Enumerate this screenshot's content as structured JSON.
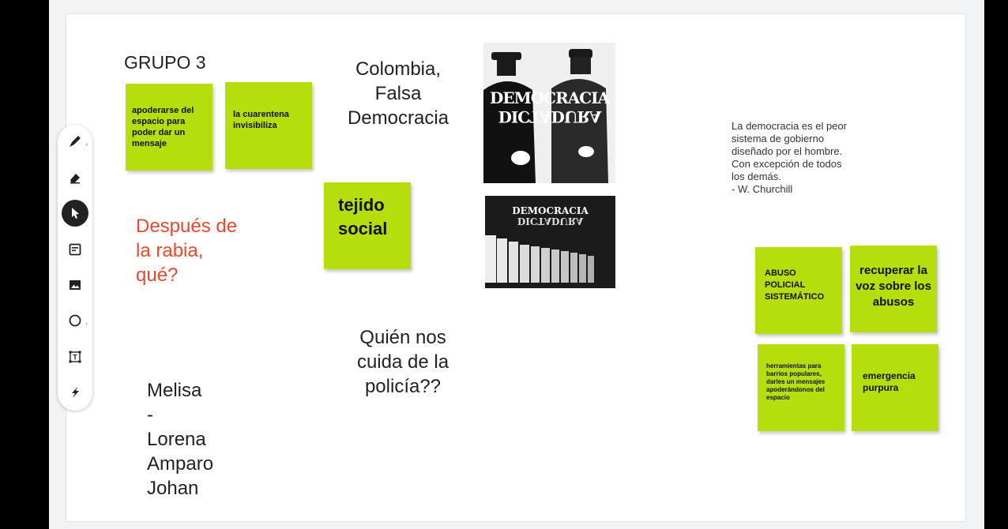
{
  "board": {
    "title": "GRUPO 3",
    "center_title": [
      "Colombia,",
      "Falsa",
      "Democracia"
    ],
    "question_red": [
      "Después de",
      "la rabia,",
      "qué?"
    ],
    "question_police": [
      "Quién nos",
      "cuida de la",
      "policía??"
    ],
    "names": [
      "Melisa",
      "-",
      "Lorena",
      "Amparo",
      "Johan"
    ],
    "quote": [
      "La democracia es el peor",
      "sistema de gobierno",
      "diseñado por el hombre.",
      "Con excepción de todos",
      "los demás.",
      "- W. Churchill"
    ],
    "image1_text": [
      "DEMOCRACIA",
      "DICTADURA"
    ],
    "image2_text": [
      "DEMOCRACIA",
      "DICTADURA"
    ]
  },
  "stickies": {
    "s1": "apoderarse del espacio para poder dar un mensaje",
    "s2": "la cuarentena invisibiliza",
    "s3": "tejido social",
    "s4": "ABUSO POLICIAL SISTEMÁTICO",
    "s5": "recuperar la voz sobre los abusos",
    "s6": "herramientas para barrios populares, darles un mensajes apoderándonos del espacio",
    "s7": "emergencia purpura"
  },
  "colors": {
    "sticky": "#b5de0c",
    "red_text": "#e8492e",
    "toolbar_active": "#222222"
  },
  "toolbar": {
    "tools": [
      "pen-icon",
      "eraser-icon",
      "cursor-icon",
      "sticky-note-icon",
      "image-icon",
      "shape-icon",
      "text-box-icon",
      "laser-icon"
    ],
    "active": "cursor-icon"
  }
}
